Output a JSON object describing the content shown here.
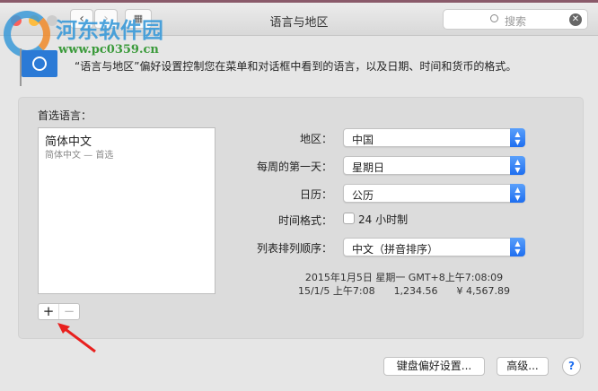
{
  "window": {
    "title": "语言与地区",
    "search_placeholder": "搜索"
  },
  "watermark": {
    "name": "河东软件园",
    "url": "www.pc0359.cn"
  },
  "header": {
    "description": "“语言与地区”偏好设置控制您在菜单和对话框中看到的语言，以及日期、时间和货币的格式。"
  },
  "languages": {
    "label": "首选语言：",
    "items": [
      {
        "name": "简体中文",
        "detail": "简体中文 — 首选"
      }
    ],
    "add": "+",
    "remove": "−"
  },
  "settings": {
    "region": {
      "label": "地区：",
      "value": "中国"
    },
    "first_day": {
      "label": "每周的第一天：",
      "value": "星期日"
    },
    "calendar": {
      "label": "日历：",
      "value": "公历"
    },
    "time_format": {
      "label": "时间格式：",
      "checkbox": "24 小时制",
      "checked": false
    },
    "sort_order": {
      "label": "列表排列顺序：",
      "value": "中文（拼音排序）"
    }
  },
  "preview": {
    "line1": "2015年1月5日 星期一 GMT+8上午7:08:09",
    "date_short": "15/1/5 上午7:08",
    "number": "1,234.56",
    "currency": "¥ 4,567.89"
  },
  "buttons": {
    "keyboard": "键盘偏好设置...",
    "advanced": "高级...",
    "help": "?"
  }
}
